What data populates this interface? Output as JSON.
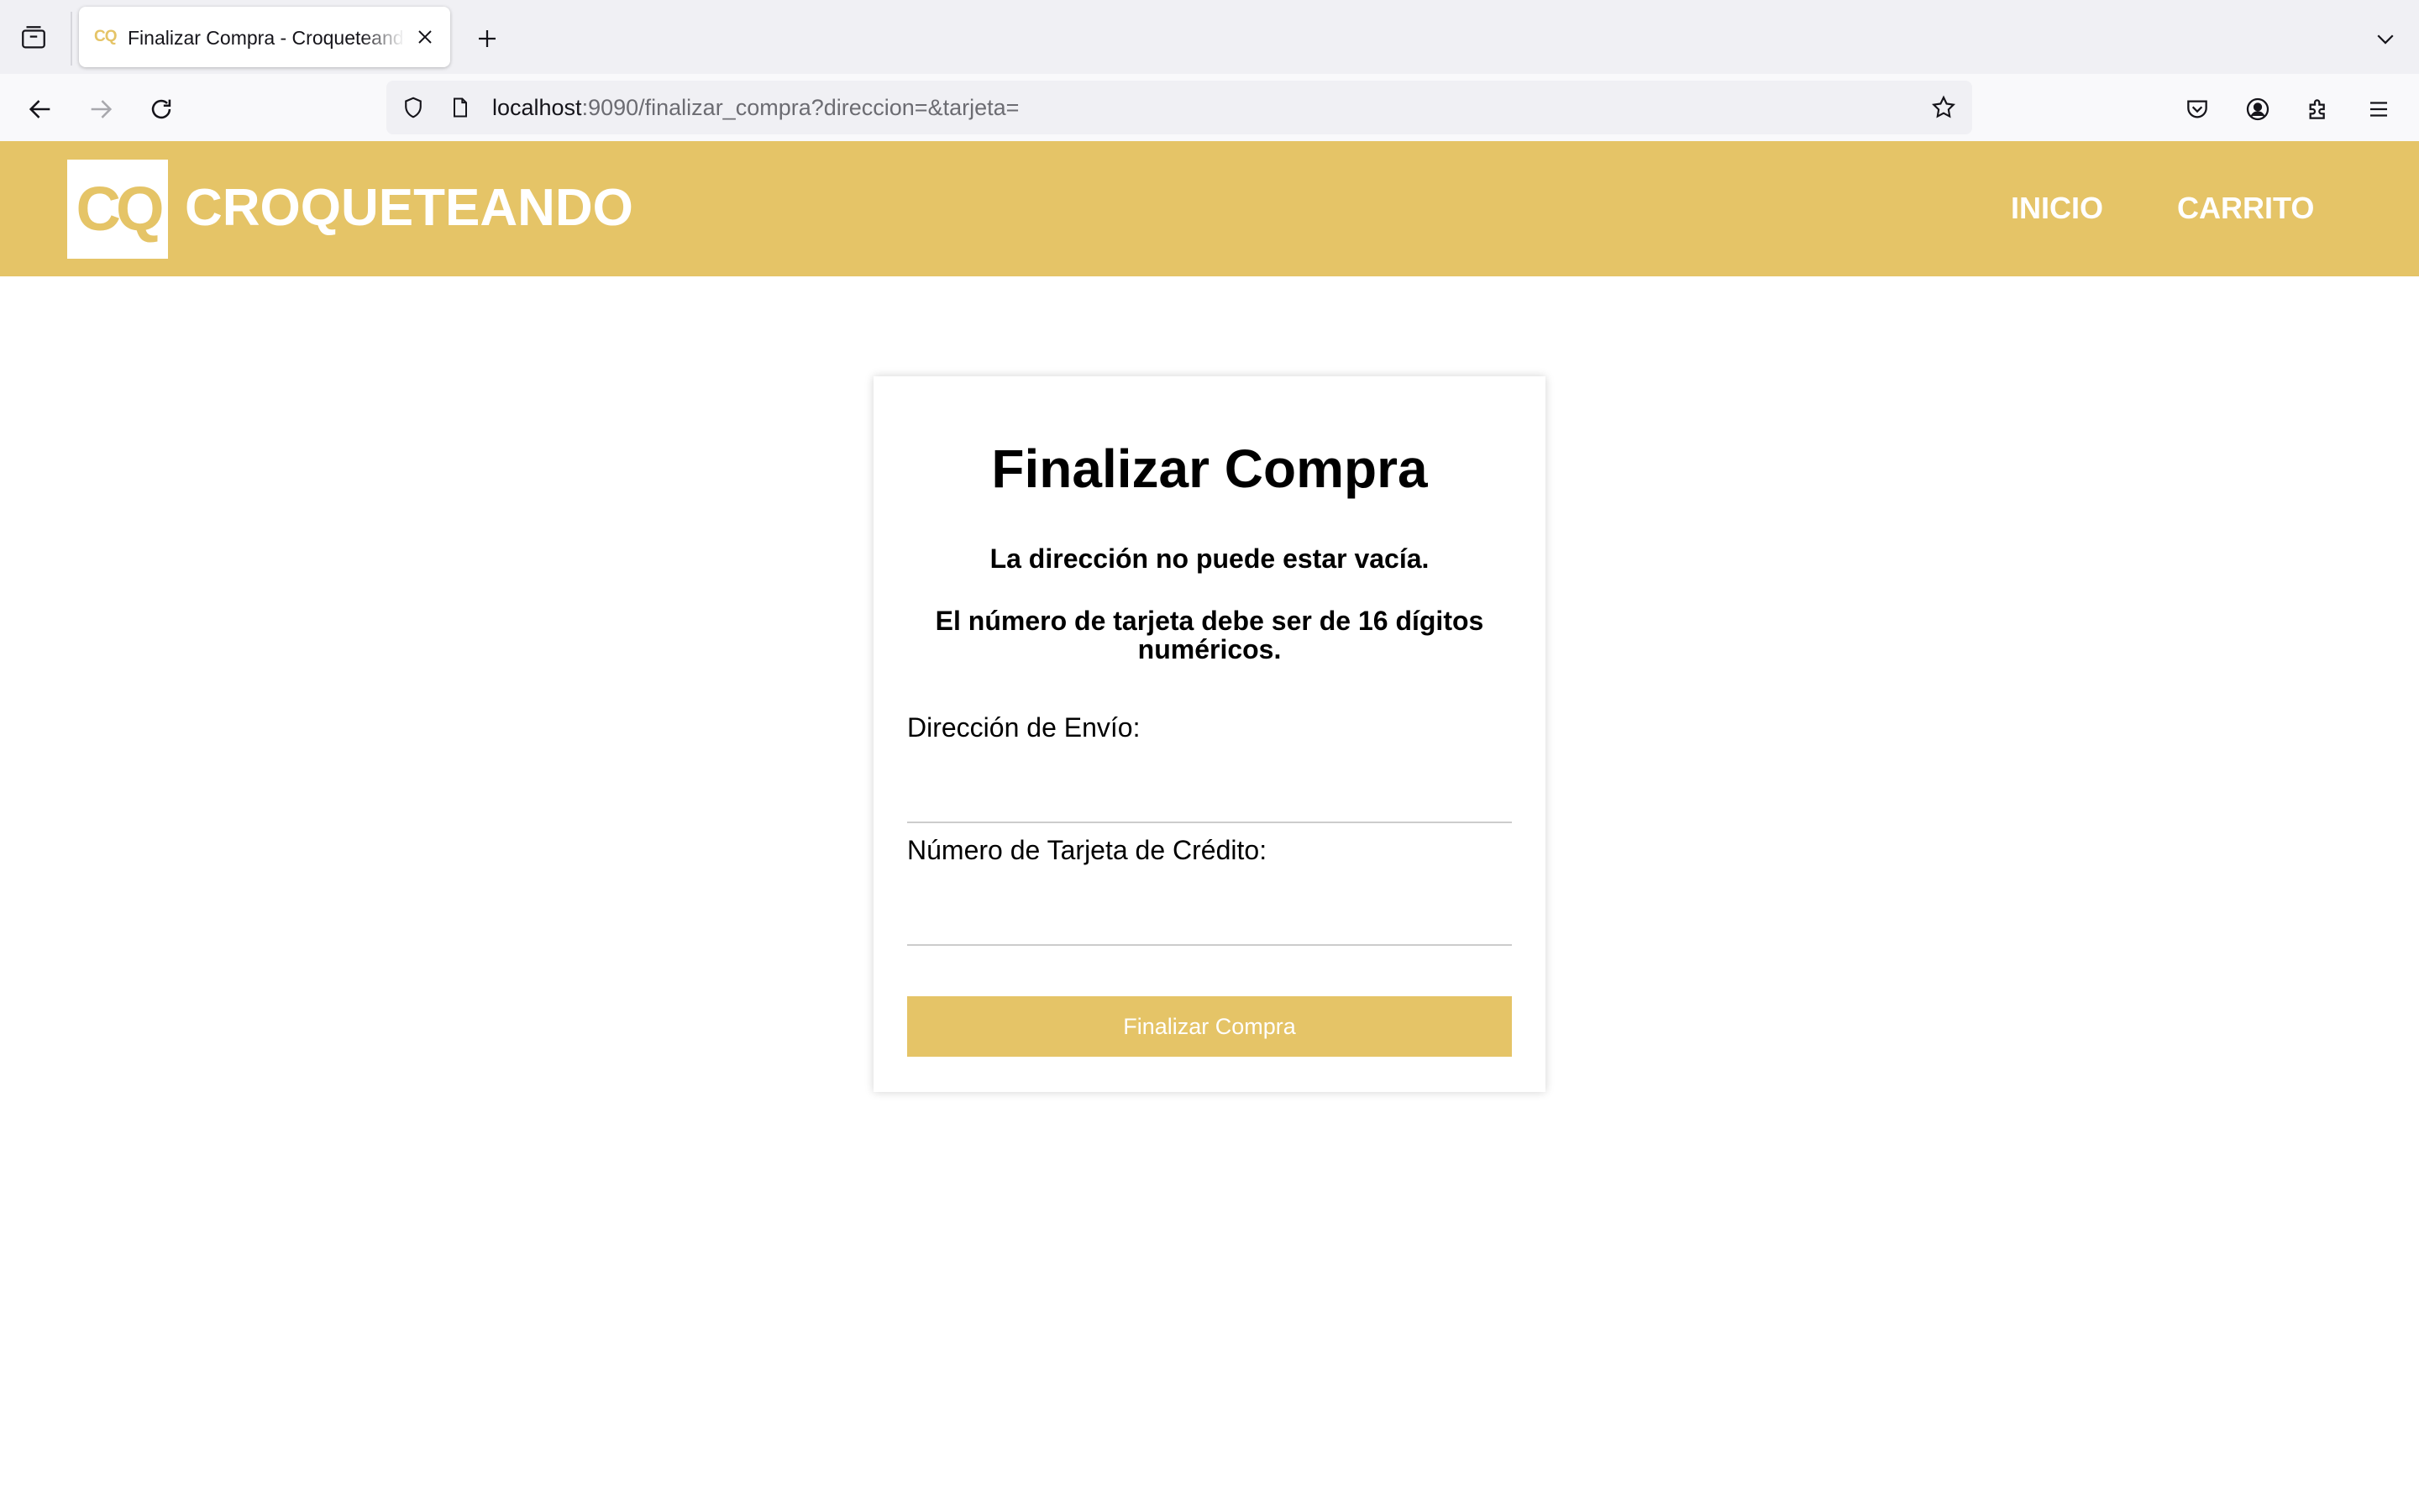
{
  "browser": {
    "tab": {
      "favicon_text": "CQ",
      "title": "Finalizar Compra - Croqueteando"
    },
    "url": {
      "host": "localhost",
      "rest": ":9090/finalizar_compra?direccion=&tarjeta="
    },
    "icons": {
      "tab_list": "tab-list-icon",
      "close_tab": "close-icon",
      "new_tab": "plus-icon",
      "tab_overflow": "chevron-down-icon",
      "back": "back-arrow-icon",
      "forward": "forward-arrow-icon",
      "reload": "reload-icon",
      "shield": "shield-icon",
      "page": "page-icon",
      "bookmark": "star-icon",
      "pocket": "pocket-icon",
      "account": "account-icon",
      "extensions": "puzzle-icon",
      "menu": "hamburger-menu-icon"
    }
  },
  "site": {
    "logo_letters": "CQ",
    "brand": "CROQUETEANDO",
    "nav": {
      "home": "INICIO",
      "cart": "CARRITO"
    },
    "colors": {
      "brand": "#e5c467",
      "text_on_brand": "#ffffff"
    }
  },
  "checkout": {
    "title": "Finalizar Compra",
    "errors": [
      "La dirección no puede estar vacía.",
      "El número de tarjeta debe ser de 16 dígitos numéricos."
    ],
    "address_label": "Dirección de Envío:",
    "address_value": "",
    "card_label": "Número de Tarjeta de Crédito:",
    "card_value": "",
    "submit_label": "Finalizar Compra"
  }
}
